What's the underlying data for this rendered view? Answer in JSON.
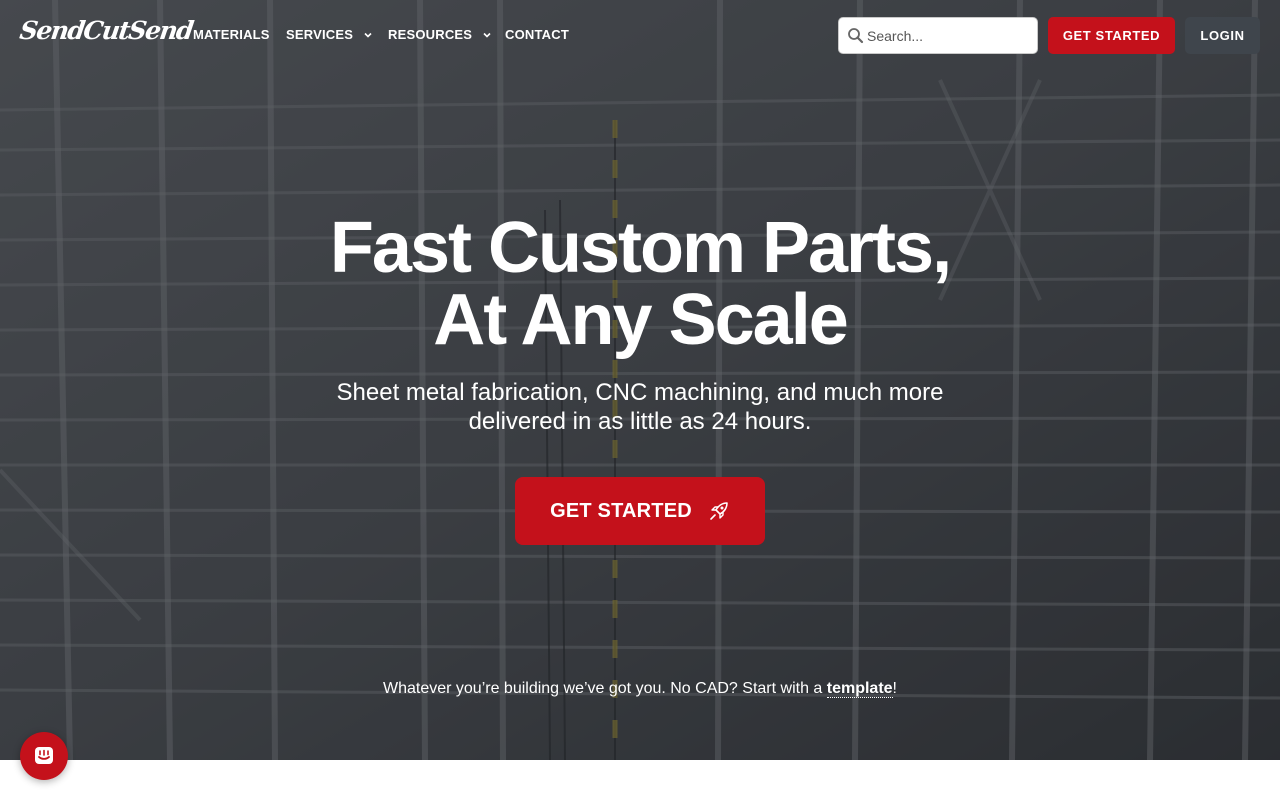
{
  "brand": {
    "logo_text": "SendCutSend",
    "accent_color": "#c4111b",
    "login_color": "#3f454c"
  },
  "nav": {
    "items": [
      {
        "label": "MATERIALS",
        "has_dropdown": false
      },
      {
        "label": "SERVICES",
        "has_dropdown": true
      },
      {
        "label": "RESOURCES",
        "has_dropdown": true
      },
      {
        "label": "CONTACT",
        "has_dropdown": false
      }
    ],
    "search": {
      "placeholder": "Search...",
      "icon": "search-icon"
    },
    "get_started_label": "GET STARTED",
    "login_label": "LOGIN"
  },
  "hero": {
    "headline_line1": "Fast Custom Parts,",
    "headline_line2": "At Any Scale",
    "subheadline_line1": "Sheet metal fabrication, CNC machining, and much more",
    "subheadline_line2": "delivered in as little as 24 hours.",
    "cta_label": "GET STARTED",
    "cta_icon": "rocket-icon",
    "tagline_prefix": "Whatever you’re building we’ve got you. No CAD? Start with a ",
    "tagline_link": "template",
    "tagline_suffix": "!"
  },
  "chat_widget": {
    "icon": "chat-icon"
  }
}
